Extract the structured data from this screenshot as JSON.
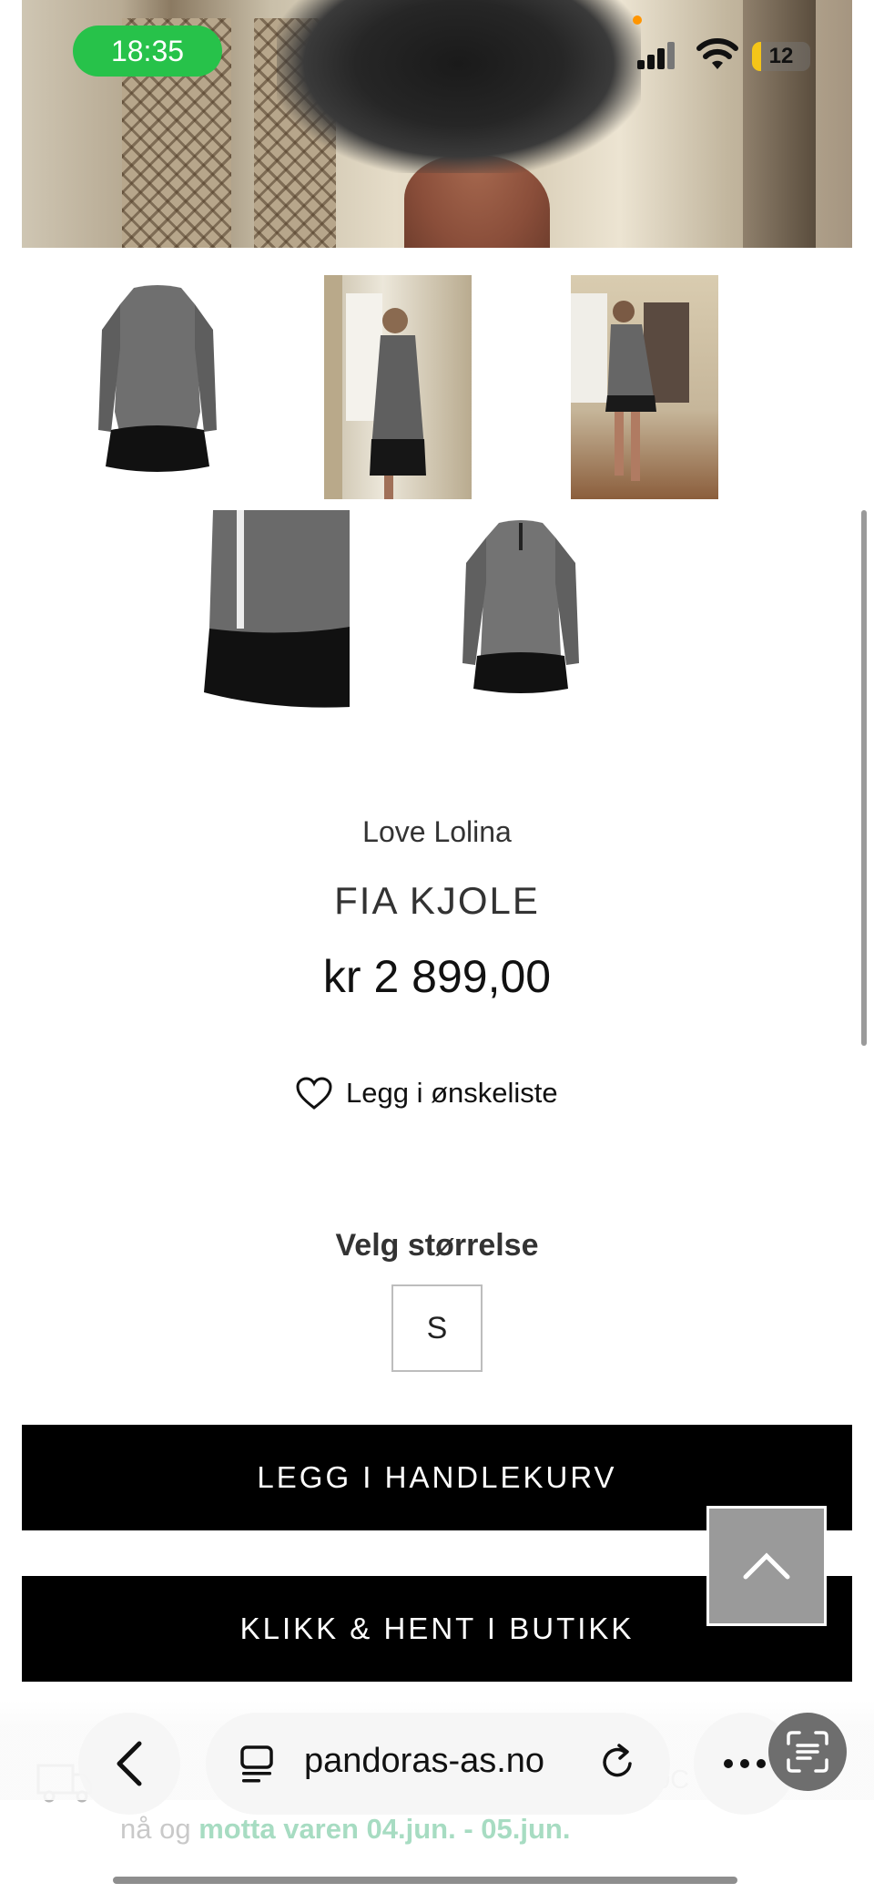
{
  "status_bar": {
    "time": "18:35",
    "battery": "12",
    "pill_color": "#27c24a"
  },
  "gallery": {
    "hero_alt": "dress-feather-hem-photo",
    "thumbnails": [
      "front-product",
      "model-side",
      "model-window",
      "hem-detail",
      "back-product"
    ]
  },
  "product": {
    "brand": "Love Lolina",
    "name": "FIA KJOLE",
    "price": "kr 2 899,00",
    "wishlist_label": "Legg i ønskeliste"
  },
  "size_selector": {
    "label": "Velg størrelse",
    "options": [
      "S"
    ]
  },
  "actions": {
    "add_to_cart": "LEGG I HANDLEKURV",
    "click_and_collect": "KLIKK & HENT I BUTIKK"
  },
  "delivery": {
    "line1_left": "t i",
    "line1_right": "0C",
    "line2_prefix": "nå og ",
    "line2_highlight": "motta varen 04.jun. - 05.jun."
  },
  "browser": {
    "url": "pandoras-as.no"
  },
  "colors": {
    "button_bg": "#000000",
    "scroll_top_bg": "#9a9a9a",
    "delivery_highlight": "#a7dcc2"
  }
}
